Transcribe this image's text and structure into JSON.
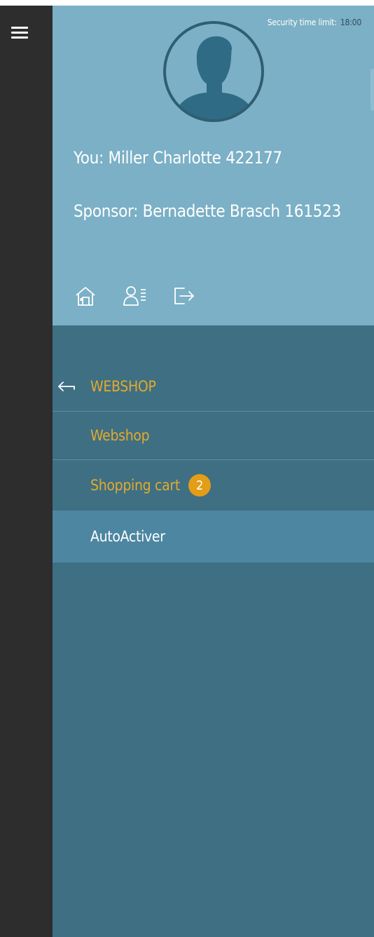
{
  "security": {
    "label": "Security time limit:",
    "time": "18:00"
  },
  "profile": {
    "you": "You: Miller Charlotte 422177",
    "sponsor": "Sponsor: Bernadette Brasch 161523",
    "icons": [
      "home-icon",
      "contact-list-icon",
      "logout-icon"
    ]
  },
  "menu": {
    "back_label": "WEBSHOP",
    "items": [
      {
        "label": "Webshop"
      },
      {
        "label": "Shopping cart",
        "badge": "2"
      },
      {
        "label": "AutoActiver",
        "active": true
      }
    ]
  },
  "colors": {
    "rail": "#2d2d2d",
    "profile_bg": "#7bb0c6",
    "menu_bg": "#3f6f83",
    "active_bg": "#4d86a1",
    "accent": "#e3aa2c",
    "badge": "#e39d17"
  }
}
